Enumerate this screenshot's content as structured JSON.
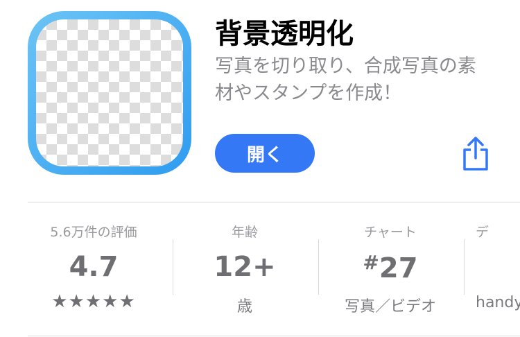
{
  "app": {
    "name": "背景透明化",
    "subtitle": "写真を切り取り、合成写真の素材やスタンプを作成！",
    "open_label": "開く",
    "icon": "checkerboard-app-icon"
  },
  "share": {
    "icon": "share-icon"
  },
  "info": {
    "ratings": {
      "label": "5.6万件の評価",
      "value": "4.7",
      "stars": "★★★★★",
      "star_rating": 4.7
    },
    "age": {
      "label": "年齢",
      "value": "12+",
      "sub": "歳"
    },
    "chart": {
      "label": "チャート",
      "rank_prefix": "#",
      "rank": "27",
      "sub": "写真／ビデオ"
    },
    "developer": {
      "label": "デ",
      "sub": "handy"
    }
  },
  "colors": {
    "accent": "#3478f6",
    "icon_gradient_start": "#6cc4f5",
    "icon_gradient_end": "#2f9cf0"
  }
}
